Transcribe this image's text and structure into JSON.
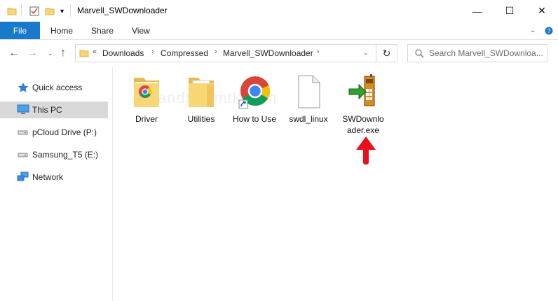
{
  "window": {
    "title": "Marvell_SWDownloader"
  },
  "ribbon": {
    "file_tab": "File",
    "tabs": [
      "Home",
      "Share",
      "View"
    ]
  },
  "address": {
    "overflow": "«",
    "crumbs": [
      "Downloads",
      "Compressed",
      "Marvell_SWDownloader"
    ]
  },
  "search": {
    "placeholder": "Search Marvell_SWDownloa..."
  },
  "nav": {
    "items": [
      {
        "label": "Quick access",
        "icon": "star-icon"
      },
      {
        "label": "This PC",
        "icon": "computer-icon",
        "selected": true
      },
      {
        "label": "pCloud Drive (P:)",
        "icon": "drive-icon"
      },
      {
        "label": "Samsung_T5 (E:)",
        "icon": "drive-icon"
      },
      {
        "label": "Network",
        "icon": "network-icon"
      }
    ]
  },
  "files": [
    {
      "label": "Driver",
      "icon": "folder-chrome-icon"
    },
    {
      "label": "Utilities",
      "icon": "folder-icon"
    },
    {
      "label": "How to Use",
      "icon": "chrome-shortcut-icon"
    },
    {
      "label": "swdl_linux",
      "icon": "blank-file-icon"
    },
    {
      "label": "SWDownlo ader.exe",
      "icon": "swdownloader-exe-icon"
    }
  ],
  "watermark": "androidmtk.com",
  "colors": {
    "file_tab": "#1979ca",
    "selected_nav": "#d9d9d9",
    "annotation_arrow": "#e8101c"
  }
}
